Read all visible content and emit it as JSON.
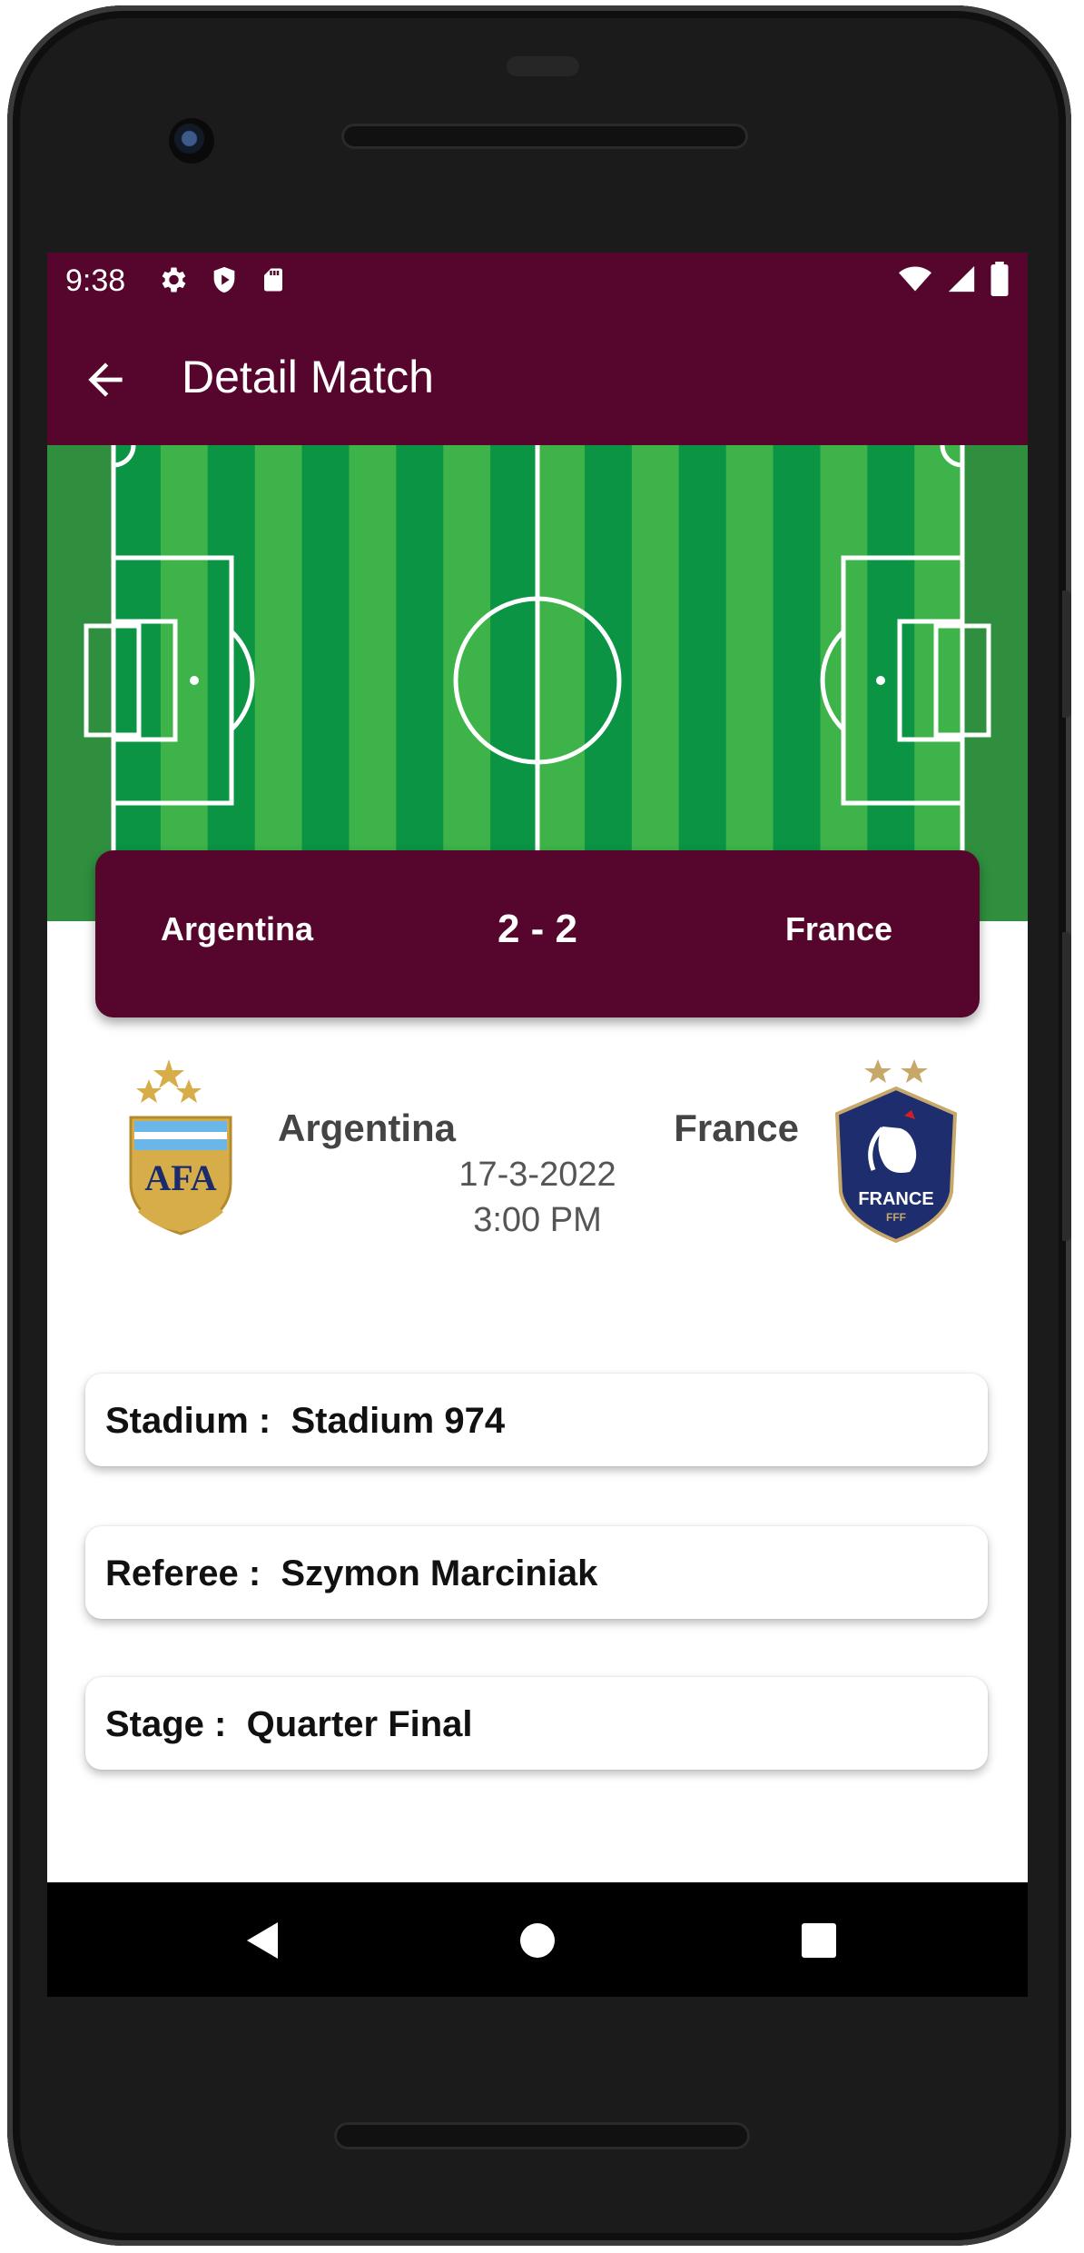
{
  "status_bar": {
    "time": "9:38",
    "left_icons": [
      "gear-icon",
      "shield-icon",
      "sd-card-icon"
    ],
    "right_icons": [
      "wifi-icon",
      "cell-signal-icon",
      "battery-icon"
    ]
  },
  "app_bar": {
    "title": "Detail Match",
    "back_icon": "arrow-left-icon"
  },
  "score_card": {
    "home_team": "Argentina",
    "score": "2 - 2",
    "away_team": "France"
  },
  "match": {
    "home_team": "Argentina",
    "away_team": "France",
    "date": "17-3-2022",
    "time": "3:00 PM",
    "home_logo": {
      "text": "AFA",
      "stars": 3,
      "colors": {
        "gold": "#d7ad4a",
        "sky": "#6bb6e8",
        "navy": "#1c2c6b"
      }
    },
    "away_logo": {
      "text": "FRANCE",
      "subtext": "FFF",
      "stars": 2,
      "colors": {
        "navy": "#1d2d6e",
        "gold": "#c7a86a",
        "red": "#d11f2a"
      }
    }
  },
  "details": [
    {
      "text": "Stadium :  Stadium 974"
    },
    {
      "text": "Referee :  Szymon Marciniak"
    },
    {
      "text": "Stage :  Quarter Final"
    }
  ],
  "nav": {
    "buttons": [
      "nav-back-icon",
      "nav-home-icon",
      "nav-recents-icon"
    ]
  },
  "colors": {
    "primary": "#56062c",
    "pitch_light": "#3db349",
    "pitch_dark": "#0a9444",
    "pitch_outer": "#2f8f3f"
  }
}
